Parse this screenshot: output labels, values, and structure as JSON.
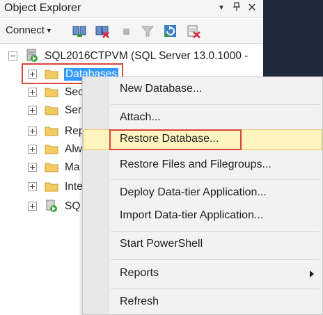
{
  "panel": {
    "title": "Object Explorer",
    "controls": {
      "dropdown": "▼",
      "pin": "२",
      "close": "✕"
    }
  },
  "toolbar": {
    "connect_label": "Connect",
    "icons": [
      "connect-object-explorer-icon",
      "disconnect-icon",
      "stop-icon",
      "filter-icon",
      "refresh-icon",
      "activity-monitor-icon"
    ]
  },
  "tree": {
    "server_label": "SQL2016CTPVM (SQL Server 13.0.1000 -",
    "nodes": [
      {
        "label": "Databases",
        "selected": true
      },
      {
        "label": "Sec"
      },
      {
        "label": "Ser"
      },
      {
        "label": "Rep"
      },
      {
        "label": "Alw"
      },
      {
        "label": "Ma"
      },
      {
        "label": "Inte"
      },
      {
        "label": "SQ"
      }
    ]
  },
  "context_menu": {
    "items": [
      {
        "label": "New Database..."
      },
      {
        "label": "Attach..."
      },
      {
        "label": "Restore Database...",
        "highlighted": true
      },
      {
        "label": "Restore Files and Filegroups..."
      },
      {
        "label": "Deploy Data-tier Application..."
      },
      {
        "label": "Import Data-tier Application..."
      },
      {
        "label": "Start PowerShell"
      },
      {
        "label": "Reports",
        "submenu": true
      },
      {
        "label": "Refresh"
      }
    ]
  },
  "colors": {
    "selection": "#3399ff",
    "highlight_box": "#d9443c",
    "menu_hover": "#fdf4bf",
    "dark_background": "#1f2a3d"
  }
}
